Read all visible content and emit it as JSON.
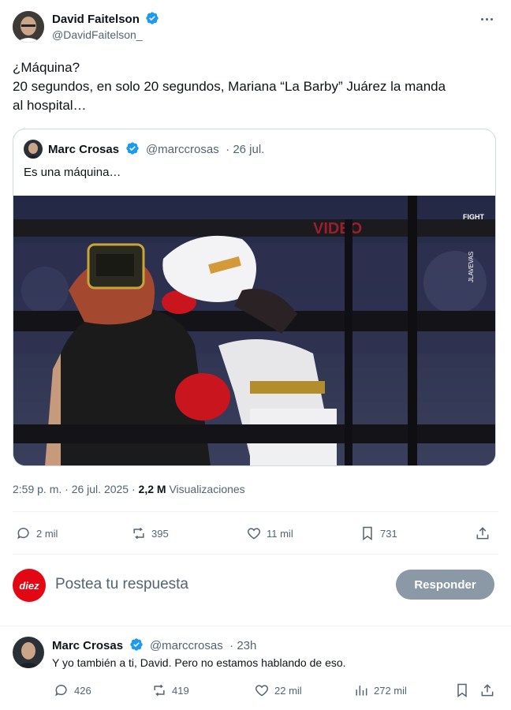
{
  "main_tweet": {
    "author_name": "David Faitelson",
    "author_handle": "@DavidFaitelson_",
    "text_line1": "¿Máquina?",
    "text_line2": "20 segundos, en solo 20 segundos, Mariana “La Barby” Juárez la manda",
    "text_line3": "al hospital…",
    "timestamp": "2:59 p. m. · 26 jul. 2025 ·",
    "views_count": "2,2 M",
    "views_label": "Visualizaciones"
  },
  "quoted_tweet": {
    "author_name": "Marc Crosas",
    "author_handle": "@marccrosas",
    "date": "· 26 jul.",
    "text": "Es una máquina…",
    "image_overlay_brand": "VIDEO",
    "image_watermark_top": "FIGHT",
    "image_watermark_side": "JLAVEVAS"
  },
  "actions": {
    "replies": "2 mil",
    "reposts": "395",
    "likes": "11 mil",
    "bookmarks": "731"
  },
  "compose": {
    "avatar_text": "diez",
    "placeholder": "Postea tu respuesta",
    "button_label": "Responder"
  },
  "reply": {
    "author_name": "Marc Crosas",
    "author_handle": "@marccrosas",
    "time": "· 23h",
    "text": "Y yo también a ti, David. Pero no estamos hablando de eso.",
    "replies": "426",
    "reposts": "419",
    "likes": "22 mil",
    "views": "272 mil"
  },
  "colors": {
    "verified_blue": "#1d9bf0",
    "text_primary": "#0f1419",
    "text_secondary": "#536471",
    "diez_red": "#e30613"
  }
}
